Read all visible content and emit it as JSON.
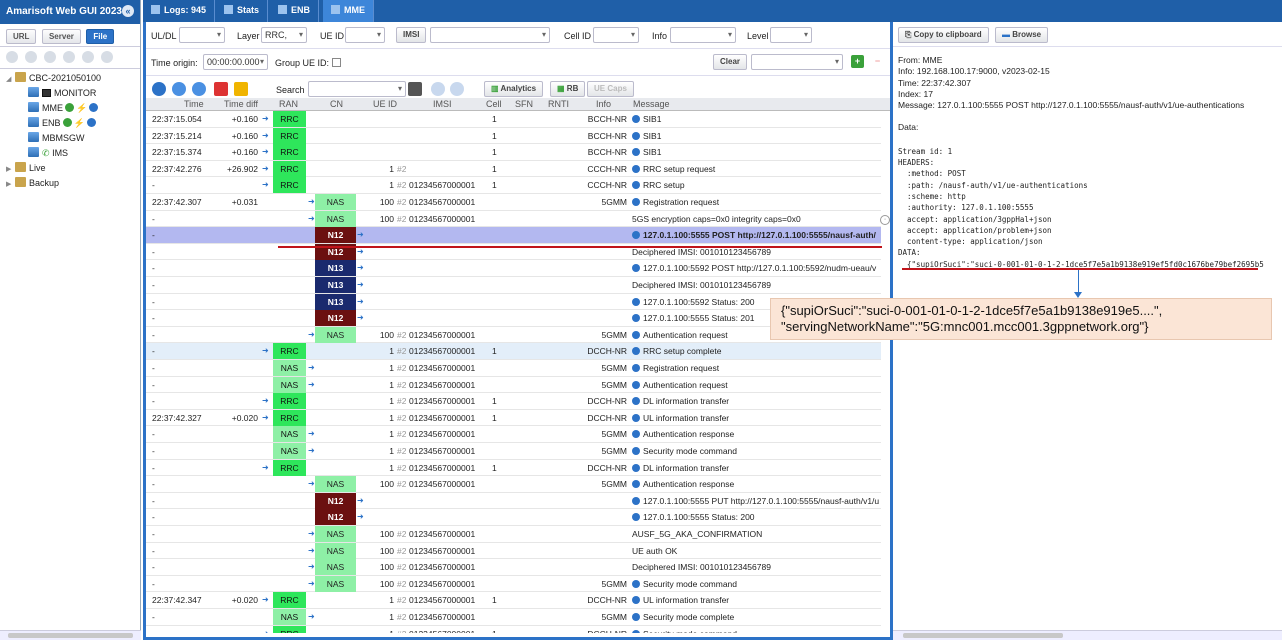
{
  "app_title": "Amarisoft Web GUI 2023...",
  "left_buttons": {
    "url": "URL",
    "server": "Server",
    "file": "File"
  },
  "tree": {
    "root": "CBC-2021050100",
    "children": [
      "MONITOR",
      "MME",
      "ENB",
      "MBMSGW",
      "IMS"
    ],
    "live": "Live",
    "backup": "Backup"
  },
  "tabs": {
    "logs": "Logs: 945",
    "stats": "Stats",
    "enb": "ENB",
    "mme": "MME"
  },
  "filters": {
    "uldl": "UL/DL",
    "layer": "Layer",
    "layer_value": "RRC,",
    "ueid": "UE ID",
    "imsi": "IMSI",
    "cellid": "Cell ID",
    "info": "Info",
    "level": "Level",
    "time_origin": "Time origin:",
    "time_origin_value": "00:00:00.000",
    "group_ue": "Group UE ID:",
    "clear": "Clear",
    "search": "Search",
    "analytics": "Analytics",
    "rb": "RB",
    "uecaps": "UE Caps"
  },
  "columns": [
    "Time",
    "Time diff",
    "RAN",
    "CN",
    "UE ID",
    "IMSI",
    "Cell",
    "SFN",
    "RNTI",
    "Info",
    "Message"
  ],
  "rows": [
    {
      "time": "22:37:15.054",
      "diff": "+0.160",
      "ran": "RRC",
      "cn": "",
      "ue": "",
      "imsi": "",
      "cell": "1",
      "info": "BCCH-NR",
      "msg": "SIB1",
      "i": true
    },
    {
      "time": "22:37:15.214",
      "diff": "+0.160",
      "ran": "RRC",
      "cn": "",
      "ue": "",
      "imsi": "",
      "cell": "1",
      "info": "BCCH-NR",
      "msg": "SIB1",
      "i": true
    },
    {
      "time": "22:37:15.374",
      "diff": "+0.160",
      "ran": "RRC",
      "cn": "",
      "ue": "",
      "imsi": "",
      "cell": "1",
      "info": "BCCH-NR",
      "msg": "SIB1",
      "i": true
    },
    {
      "time": "22:37:42.276",
      "diff": "+26.902",
      "ran": "RRC",
      "cn": "",
      "ue": "1",
      "ueh": "#2",
      "imsi": "",
      "cell": "1",
      "info": "CCCH-NR",
      "msg": "RRC setup request",
      "i": true
    },
    {
      "time": "-",
      "diff": "",
      "ran": "RRC",
      "cn": "",
      "ue": "1",
      "ueh": "#2",
      "imsi": "01234567000001",
      "cell": "1",
      "info": "CCCH-NR",
      "msg": "RRC setup",
      "i": true
    },
    {
      "time": "22:37:42.307",
      "diff": "+0.031",
      "ran": "",
      "cn": "NAS",
      "ue": "100",
      "ueh": "#2",
      "imsi": "01234567000001",
      "cell": "",
      "info": "5GMM",
      "msg": "Registration request",
      "i": true
    },
    {
      "time": "-",
      "diff": "",
      "ran": "",
      "cn": "NAS",
      "ue": "100",
      "ueh": "#2",
      "imsi": "01234567000001",
      "cell": "",
      "info": "",
      "msg": "5GS encryption caps=0x0 integrity caps=0x0",
      "i": false
    },
    {
      "time": "-",
      "diff": "",
      "ran": "",
      "cn": "N12",
      "ue": "",
      "imsi": "",
      "cell": "",
      "info": "",
      "msg": "127.0.1.100:5555 POST http://127.0.1.100:5555/nausf-auth/",
      "i": true,
      "sel": 1
    },
    {
      "time": "-",
      "diff": "",
      "ran": "",
      "cn": "N12",
      "ue": "",
      "imsi": "",
      "cell": "",
      "info": "",
      "msg": "Deciphered IMSI: 001010123456789",
      "i": false
    },
    {
      "time": "-",
      "diff": "",
      "ran": "",
      "cn": "N13",
      "ue": "",
      "imsi": "",
      "cell": "",
      "info": "",
      "msg": "127.0.1.100:5592 POST http://127.0.1.100:5592/nudm-ueau/v",
      "i": true
    },
    {
      "time": "-",
      "diff": "",
      "ran": "",
      "cn": "N13",
      "ue": "",
      "imsi": "",
      "cell": "",
      "info": "",
      "msg": "Deciphered IMSI: 001010123456789",
      "i": false
    },
    {
      "time": "-",
      "diff": "",
      "ran": "",
      "cn": "N13",
      "ue": "",
      "imsi": "",
      "cell": "",
      "info": "",
      "msg": "127.0.1.100:5592 Status: 200",
      "i": true
    },
    {
      "time": "-",
      "diff": "",
      "ran": "",
      "cn": "N12",
      "ue": "",
      "imsi": "",
      "cell": "",
      "info": "",
      "msg": "127.0.1.100:5555 Status: 201",
      "i": true
    },
    {
      "time": "-",
      "diff": "",
      "ran": "",
      "cn": "NAS",
      "ue": "100",
      "ueh": "#2",
      "imsi": "01234567000001",
      "cell": "",
      "info": "5GMM",
      "msg": "Authentication request",
      "i": true
    },
    {
      "time": "-",
      "diff": "",
      "ran": "RRC",
      "cn": "",
      "ue": "1",
      "ueh": "#2",
      "imsi": "01234567000001",
      "cell": "1",
      "info": "DCCH-NR",
      "msg": "RRC setup complete",
      "i": true,
      "sel": 2
    },
    {
      "time": "-",
      "diff": "",
      "ran": "NAS",
      "cn": "",
      "ue": "1",
      "ueh": "#2",
      "imsi": "01234567000001",
      "cell": "",
      "info": "5GMM",
      "msg": "Registration request",
      "i": true
    },
    {
      "time": "-",
      "diff": "",
      "ran": "NAS",
      "cn": "",
      "ue": "1",
      "ueh": "#2",
      "imsi": "01234567000001",
      "cell": "",
      "info": "5GMM",
      "msg": "Authentication request",
      "i": true
    },
    {
      "time": "-",
      "diff": "",
      "ran": "RRC",
      "cn": "",
      "ue": "1",
      "ueh": "#2",
      "imsi": "01234567000001",
      "cell": "1",
      "info": "DCCH-NR",
      "msg": "DL information transfer",
      "i": true
    },
    {
      "time": "22:37:42.327",
      "diff": "+0.020",
      "ran": "RRC",
      "cn": "",
      "ue": "1",
      "ueh": "#2",
      "imsi": "01234567000001",
      "cell": "1",
      "info": "DCCH-NR",
      "msg": "UL information transfer",
      "i": true
    },
    {
      "time": "-",
      "diff": "",
      "ran": "NAS",
      "cn": "",
      "ue": "1",
      "ueh": "#2",
      "imsi": "01234567000001",
      "cell": "",
      "info": "5GMM",
      "msg": "Authentication response",
      "i": true
    },
    {
      "time": "-",
      "diff": "",
      "ran": "NAS",
      "cn": "",
      "ue": "1",
      "ueh": "#2",
      "imsi": "01234567000001",
      "cell": "",
      "info": "5GMM",
      "msg": "Security mode command",
      "i": true
    },
    {
      "time": "-",
      "diff": "",
      "ran": "RRC",
      "cn": "",
      "ue": "1",
      "ueh": "#2",
      "imsi": "01234567000001",
      "cell": "1",
      "info": "DCCH-NR",
      "msg": "DL information transfer",
      "i": true
    },
    {
      "time": "-",
      "diff": "",
      "ran": "",
      "cn": "NAS",
      "ue": "100",
      "ueh": "#2",
      "imsi": "01234567000001",
      "cell": "",
      "info": "5GMM",
      "msg": "Authentication response",
      "i": true
    },
    {
      "time": "-",
      "diff": "",
      "ran": "",
      "cn": "N12",
      "ue": "",
      "imsi": "",
      "cell": "",
      "info": "",
      "msg": "127.0.1.100:5555 PUT http://127.0.1.100:5555/nausf-auth/v1/u",
      "i": true
    },
    {
      "time": "-",
      "diff": "",
      "ran": "",
      "cn": "N12",
      "ue": "",
      "imsi": "",
      "cell": "",
      "info": "",
      "msg": "127.0.1.100:5555 Status: 200",
      "i": true
    },
    {
      "time": "-",
      "diff": "",
      "ran": "",
      "cn": "NAS",
      "ue": "100",
      "ueh": "#2",
      "imsi": "01234567000001",
      "cell": "",
      "info": "",
      "msg": "AUSF_5G_AKA_CONFIRMATION",
      "i": false
    },
    {
      "time": "-",
      "diff": "",
      "ran": "",
      "cn": "NAS",
      "ue": "100",
      "ueh": "#2",
      "imsi": "01234567000001",
      "cell": "",
      "info": "",
      "msg": "UE auth OK",
      "i": false
    },
    {
      "time": "-",
      "diff": "",
      "ran": "",
      "cn": "NAS",
      "ue": "100",
      "ueh": "#2",
      "imsi": "01234567000001",
      "cell": "",
      "info": "",
      "msg": "Deciphered IMSI: 001010123456789",
      "i": false
    },
    {
      "time": "-",
      "diff": "",
      "ran": "",
      "cn": "NAS",
      "ue": "100",
      "ueh": "#2",
      "imsi": "01234567000001",
      "cell": "",
      "info": "5GMM",
      "msg": "Security mode command",
      "i": true
    },
    {
      "time": "22:37:42.347",
      "diff": "+0.020",
      "ran": "RRC",
      "cn": "",
      "ue": "1",
      "ueh": "#2",
      "imsi": "01234567000001",
      "cell": "1",
      "info": "DCCH-NR",
      "msg": "UL information transfer",
      "i": true
    },
    {
      "time": "-",
      "diff": "",
      "ran": "NAS",
      "cn": "",
      "ue": "1",
      "ueh": "#2",
      "imsi": "01234567000001",
      "cell": "",
      "info": "5GMM",
      "msg": "Security mode complete",
      "i": true
    },
    {
      "time": "-",
      "diff": "",
      "ran": "RRC",
      "cn": "",
      "ue": "1",
      "ueh": "#2",
      "imsi": "01234567000001",
      "cell": "1",
      "info": "DCCH-NR",
      "msg": "Security mode command",
      "i": true
    }
  ],
  "right_panel": {
    "copy": "Copy to clipboard",
    "browse": "Browse",
    "lines": [
      "From: MME",
      "Info: 192.168.100.17:9000, v2023-02-15",
      "Time: 22:37:42.307",
      "Index: 17",
      "Message: 127.0.1.100:5555 POST http://127.0.1.100:5555/nausf-auth/v1/ue-authentications",
      "",
      "Data:"
    ],
    "pre": "Stream id: 1\nHEADERS:\n  :method: POST\n  :path: /nausf-auth/v1/ue-authentications\n  :scheme: http\n  :authority: 127.0.1.100:5555\n  accept: application/3gppHal+json\n  accept: application/problem+json\n  content-type: application/json\nDATA:\n  {\"supiOrSuci\":\"suci-0-001-01-0-1-2-1dce5f7e5a1b9138e919ef5fd0c1676be79bef2695b5"
  },
  "callout": {
    "line1": "{\"supiOrSuci\":\"suci-0-001-01-0-1-2-1dce5f7e5a1b9138e919e5....\",",
    "line2": " \"servingNetworkName\":\"5G:mnc001.mcc001.3gppnetwork.org\"}"
  }
}
